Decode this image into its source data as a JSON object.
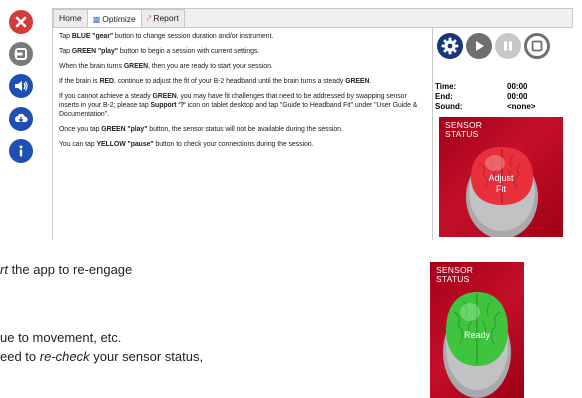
{
  "window": {
    "tabs": [
      {
        "label": "Home",
        "icon": ""
      },
      {
        "label": "Optimize",
        "icon": "optimize-icon"
      },
      {
        "label": "Report",
        "icon": "report-icon"
      }
    ],
    "active_tab": "Optimize"
  },
  "sidebar": {
    "icons": [
      "close-icon",
      "exit-icon",
      "sound-icon",
      "cloud-download-icon",
      "info-icon"
    ],
    "colors": {
      "close": "#d33b3b",
      "exit": "#7a7a7a",
      "primary": "#1f4fb4"
    }
  },
  "instructions": [
    {
      "parts": [
        {
          "t": "Tap "
        },
        {
          "t": "BLUE \"gear\"",
          "b": true
        },
        {
          "t": " button to change session duration and/or instrument."
        }
      ]
    },
    {
      "parts": [
        {
          "t": "Tap "
        },
        {
          "t": "GREEN \"play\"",
          "b": true
        },
        {
          "t": " button to begin a session with current settings."
        }
      ]
    },
    {
      "parts": [
        {
          "t": "When the brain turns "
        },
        {
          "t": "GREEN",
          "b": true
        },
        {
          "t": ", then you are ready to start your session."
        }
      ]
    },
    {
      "parts": [
        {
          "t": "If the brain is "
        },
        {
          "t": "RED",
          "b": true
        },
        {
          "t": ", continue to adjust the fit of your B-2 headband until the brain turns a steady "
        },
        {
          "t": "GREEN",
          "b": true
        },
        {
          "t": "."
        }
      ]
    },
    {
      "parts": [
        {
          "t": "If you cannot achieve a steady "
        },
        {
          "t": "GREEN",
          "b": true
        },
        {
          "t": ", you may have fit challenges that need to be addressed by swapping sensor inserts in your B-2; please tap "
        },
        {
          "t": "Support '?'",
          "b": true
        },
        {
          "t": " icon on tablet desktop and tap \"Guide to Headband Fit\" under \"User Guide & Documentation\"."
        }
      ]
    },
    {
      "parts": [
        {
          "t": "Once you tap "
        },
        {
          "t": "GREEN \"play\"",
          "b": true
        },
        {
          "t": " button, the sensor status will not be available during the session."
        }
      ]
    },
    {
      "parts": [
        {
          "t": "You can tap "
        },
        {
          "t": "YELLOW \"pause\"",
          "b": true
        },
        {
          "t": " button to check your connections during the session."
        }
      ]
    }
  ],
  "controls": {
    "buttons": [
      "gear-icon",
      "play-icon",
      "pause-icon",
      "stop-icon"
    ]
  },
  "status": {
    "time_label": "Time:",
    "time_value": "00:00",
    "end_label": "End:",
    "end_value": "00:00",
    "sound_label": "Sound:",
    "sound_value": "<none>"
  },
  "sensor_top": {
    "title_line1": "SENSOR",
    "title_line2": "STATUS",
    "brain_line1": "Adjust",
    "brain_line2": "Fit",
    "brain_color": "#e8303c"
  },
  "sensor_bottom": {
    "title_line1": "SENSOR",
    "title_line2": "STATUS",
    "brain_label": "Ready",
    "brain_color": "#3fc43f"
  },
  "doc_lines": [
    {
      "italic": "rt",
      "rest": " the app to re-engage"
    },
    {
      "italic": "",
      "rest": "ue to movement, etc."
    },
    {
      "prefix": "eed to ",
      "italic": "re-check",
      "rest": " your sensor status,"
    }
  ]
}
